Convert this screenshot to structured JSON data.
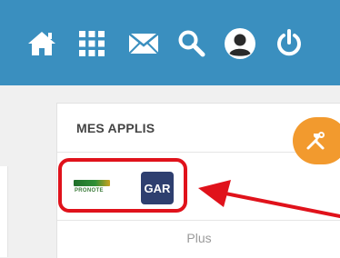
{
  "topbar": {
    "color": "#3a8fbf",
    "icons": [
      "home-icon",
      "apps-grid-icon",
      "mail-icon",
      "search-icon",
      "user-account-icon",
      "power-icon"
    ]
  },
  "apps_card": {
    "title": "MES APPLIS",
    "apps": [
      {
        "name": "pronote",
        "label": "PRONOTE"
      },
      {
        "name": "gar",
        "label": "GAR"
      }
    ],
    "more_label": "Plus"
  },
  "tools_button": {
    "icon": "hammer-wrench-icon",
    "color": "#f29a2e"
  },
  "annotation": {
    "highlight_color": "#e0121b",
    "arrow_color": "#e0121b"
  }
}
